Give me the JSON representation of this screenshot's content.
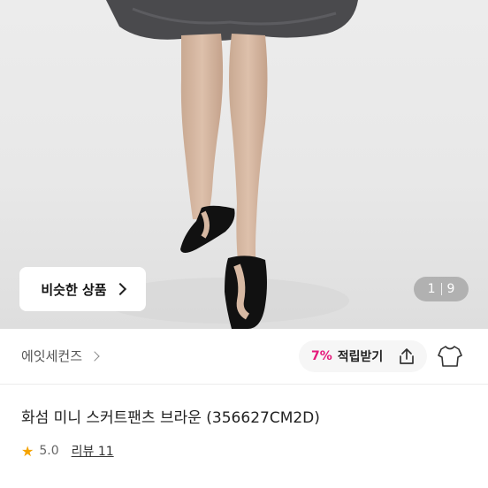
{
  "hero": {
    "similar_label": "비슷한 상품",
    "pager": {
      "current": "1",
      "total": "9"
    }
  },
  "brand": {
    "name": "에잇세컨즈"
  },
  "points": {
    "percent": "7%",
    "label": "적립받기"
  },
  "product": {
    "title": "화섬 미니 스커트팬츠 브라운 (356627CM2D)"
  },
  "rating": {
    "score": "5.0",
    "review_label": "리뷰 11"
  },
  "colors": {
    "accent": "#e5197b",
    "star": "#f5a300"
  },
  "icons": [
    "chevron-right-icon",
    "share-icon",
    "shirt-icon",
    "star-icon"
  ]
}
